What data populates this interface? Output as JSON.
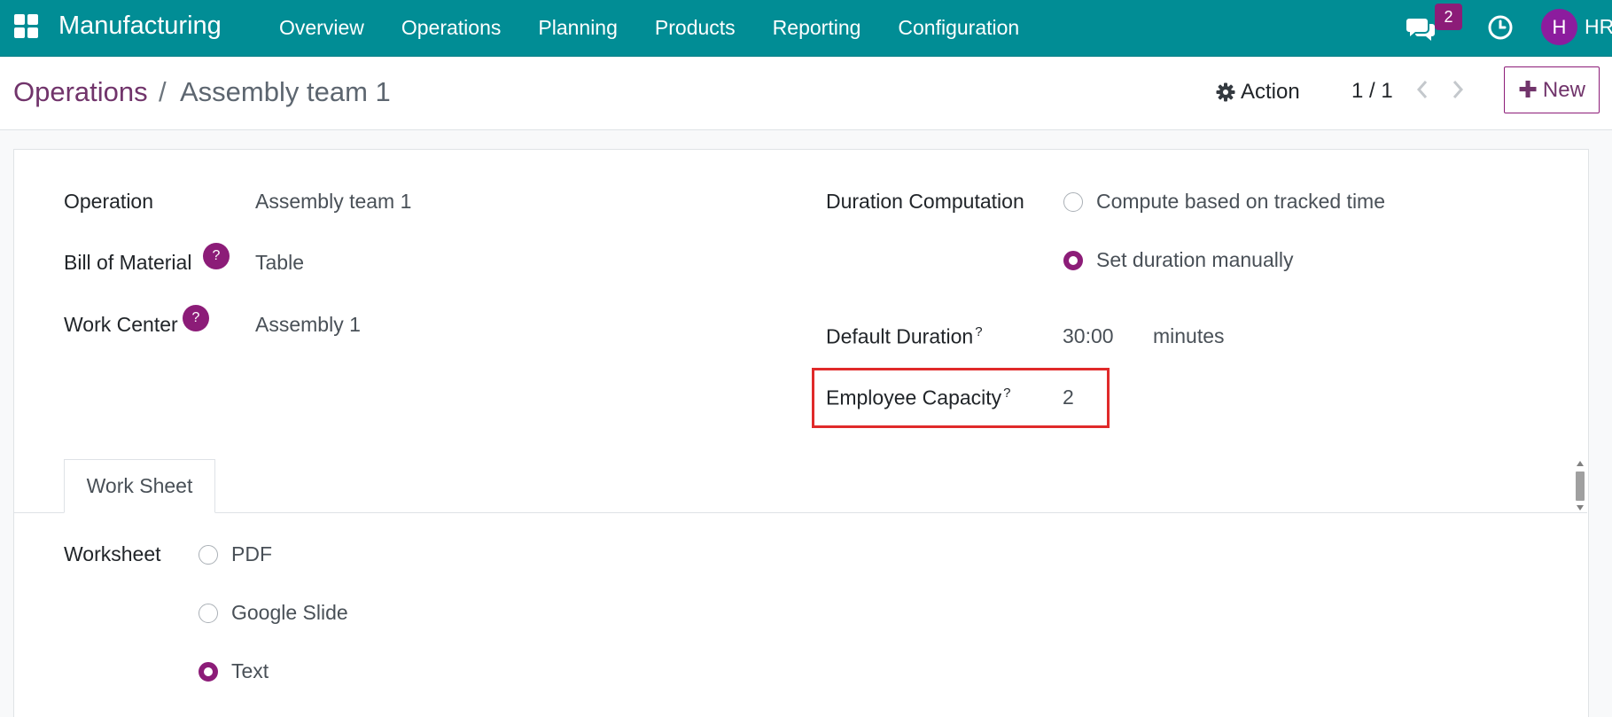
{
  "navbar": {
    "app_name": "Manufacturing",
    "menu": [
      "Overview",
      "Operations",
      "Planning",
      "Products",
      "Reporting",
      "Configuration"
    ],
    "chat_count": "2",
    "avatar_initial": "H",
    "user_label": "HR"
  },
  "control": {
    "breadcrumb_parent": "Operations",
    "breadcrumb_sep": "/",
    "breadcrumb_current": "Assembly team 1",
    "action_label": "Action",
    "pager": "1 / 1",
    "new_label": "New"
  },
  "form": {
    "operation_label": "Operation",
    "operation_value": "Assembly team 1",
    "bom_label": "Bill of Material",
    "bom_value": "Table",
    "workcenter_label": "Work Center",
    "workcenter_value": "Assembly 1",
    "help_mark": "?",
    "duration_computation_label": "Duration Computation",
    "duration_options": [
      "Compute based on tracked time",
      "Set duration manually"
    ],
    "duration_selected": "Set duration manually",
    "default_duration_label": "Default Duration",
    "default_duration_value": "30:00",
    "default_duration_unit": "minutes",
    "employee_capacity_label": "Employee Capacity",
    "employee_capacity_value": "2",
    "highlight_color": "#e02a2a"
  },
  "tabs": [
    "Work Sheet"
  ],
  "worksheet": {
    "label": "Worksheet",
    "options": [
      "PDF",
      "Google Slide",
      "Text"
    ],
    "selected": "Text"
  },
  "colors": {
    "navbar": "#018d95",
    "primary": "#8c1c78",
    "breadcrumb_link": "#71346b"
  }
}
